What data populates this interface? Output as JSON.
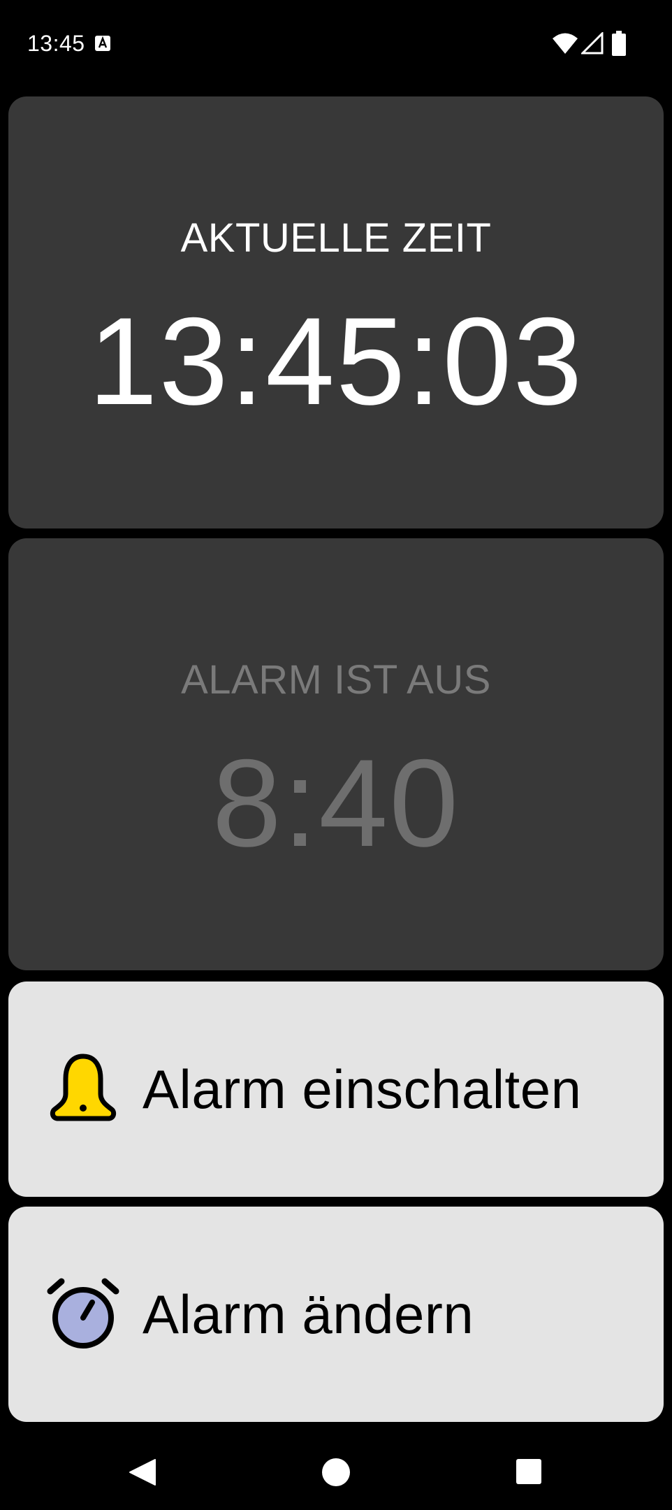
{
  "status_bar": {
    "time": "13:45",
    "icons": [
      "keyboard-a-icon",
      "wifi-icon",
      "signal-icon",
      "battery-icon"
    ]
  },
  "current_time_card": {
    "label": "AKTUELLE ZEIT",
    "value": "13:45:03"
  },
  "alarm_card": {
    "label": "ALARM IST AUS",
    "value": "8:40"
  },
  "actions": {
    "enable_alarm": {
      "label": "Alarm einschalten",
      "icon": "bell-icon"
    },
    "change_alarm": {
      "label": "Alarm ändern",
      "icon": "alarm-clock-icon"
    }
  },
  "navigation": {
    "icons": [
      "back-icon",
      "home-icon",
      "recents-icon"
    ]
  },
  "colors": {
    "background": "#000000",
    "card": "#383838",
    "button": "#e4e4e4",
    "bell": "#ffd700",
    "alarm_clock_face": "#a9b0de",
    "dimmed_text": "#6e6e6e"
  }
}
